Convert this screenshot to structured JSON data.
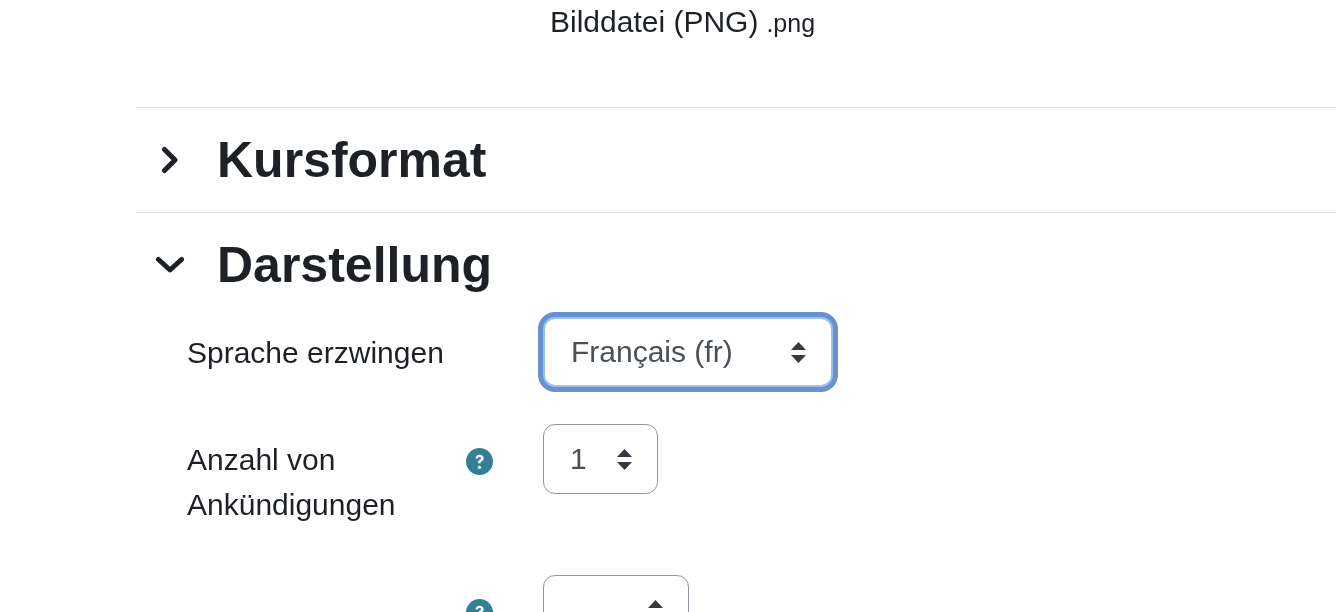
{
  "file_type": {
    "label": "Bilddatei (PNG)",
    "extension": ".png"
  },
  "sections": [
    {
      "title": "Kursformat",
      "expanded": false
    },
    {
      "title": "Darstellung",
      "expanded": true,
      "fields": [
        {
          "label": "Sprache erzwingen",
          "help": false,
          "value": "Français (fr)",
          "focused": true
        },
        {
          "label": "Anzahl von Ankündigungen",
          "help": true,
          "value": "1",
          "focused": false
        },
        {
          "help": true,
          "focused": false
        }
      ]
    }
  ]
}
